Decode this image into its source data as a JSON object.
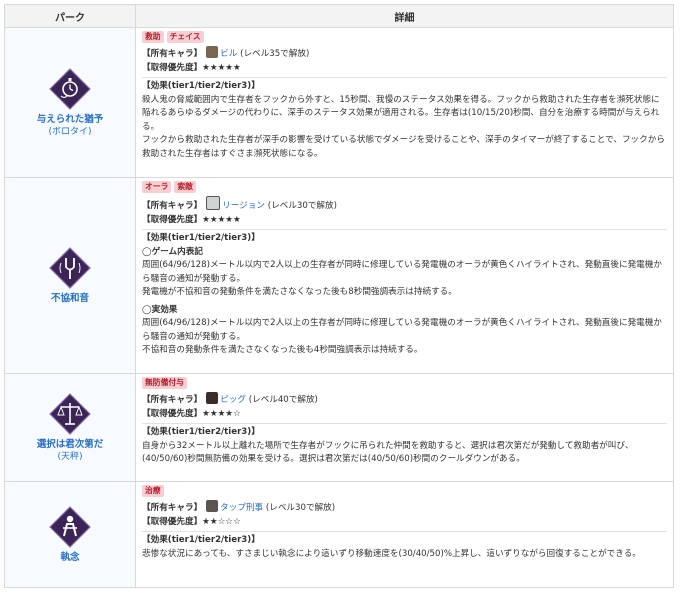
{
  "header": {
    "col_perk": "パーク",
    "col_detail": "詳細"
  },
  "labels": {
    "character": "【所有キャラ】",
    "priority": "【取得優先度】",
    "effect": "【効果(tier1/tier2/tier3)】"
  },
  "perks": [
    {
      "name": "与えられた猶予",
      "sub": "(ボロタイ)",
      "icon": "pocket-watch-icon",
      "tags": [
        "救助",
        "チェイス"
      ],
      "character": "ビル",
      "unlock": " (レベル35で解放)",
      "stars": "★★★★★",
      "effect_lines": [
        "殺人鬼の脅威範囲内で生存者をフックから外すと、15秒間、我慢のステータス効果を得る。フックから救助された生存者を瀕死状態に陥れるあらゆるダメージの代わりに、深手のステータス効果が適用される。生存者は(10/15/20)秒間、自分を治療する時間が与えられる。",
        "フックから救助された生存者が深手の影響を受けている状態でダメージを受けることや、深手のタイマーが終了することで、フックから救助された生存者はすぐさま瀕死状態になる。"
      ]
    },
    {
      "name": "不協和音",
      "sub": "",
      "icon": "tuning-fork-icon",
      "tags": [
        "オーラ",
        "索敵"
      ],
      "character": "リージョン",
      "unlock": " (レベル30で解放)",
      "stars": "★★★★★",
      "sections": [
        {
          "title": "◯ゲーム内表記",
          "lines": [
            "周囲(64/96/128)メートル以内で2人以上の生存者が同時に修理している発電機のオーラが黄色くハイライトされ、発動直後に発電機から騒音の通知が発動する。",
            "発電機が不協和音の発動条件を満たさなくなった後も8秒間強調表示は持続する。"
          ]
        },
        {
          "title": "◯実効果",
          "lines": [
            "周囲(64/96/128)メートル以内で2人以上の生存者が同時に修理している発電機のオーラが黄色くハイライトされ、発動直後に発電機から騒音の通知が発動する。",
            "不協和音の発動条件を満たさなくなった後も4秒間強調表示は持続する。"
          ]
        }
      ]
    },
    {
      "name": "選択は君次第だ",
      "sub": "(天秤)",
      "icon": "scales-icon",
      "tags": [
        "無防備付与"
      ],
      "character": "ピッグ",
      "unlock": " (レベル40で解放)",
      "stars": "★★★★☆",
      "effect_lines": [
        "自身から32メートル以上離れた場所で生存者がフックに吊られた仲間を救助すると、選択は君次第だが発動して救助者が叫び、(40/50/60)秒間無防備の効果を受ける。選択は君次第だは(40/50/60)秒間のクールダウンがある。"
      ]
    },
    {
      "name": "執念",
      "sub": "",
      "icon": "crawling-survivor-icon",
      "tags": [
        "治療"
      ],
      "character": "タップ刑事",
      "unlock": " (レベル30で解放)",
      "stars": "★★☆☆☆",
      "effect_lines": [
        "悲惨な状況にあっても、すさまじい執念により這いずり移動速度を(30/40/50)%上昇し、這いずりながら回復することができる。"
      ]
    }
  ],
  "colors": {
    "link": "#2a6ebd",
    "tag_bg": "#f7cfd3",
    "tag_fg": "#b0202c",
    "icon_bg": "#3b2456"
  }
}
